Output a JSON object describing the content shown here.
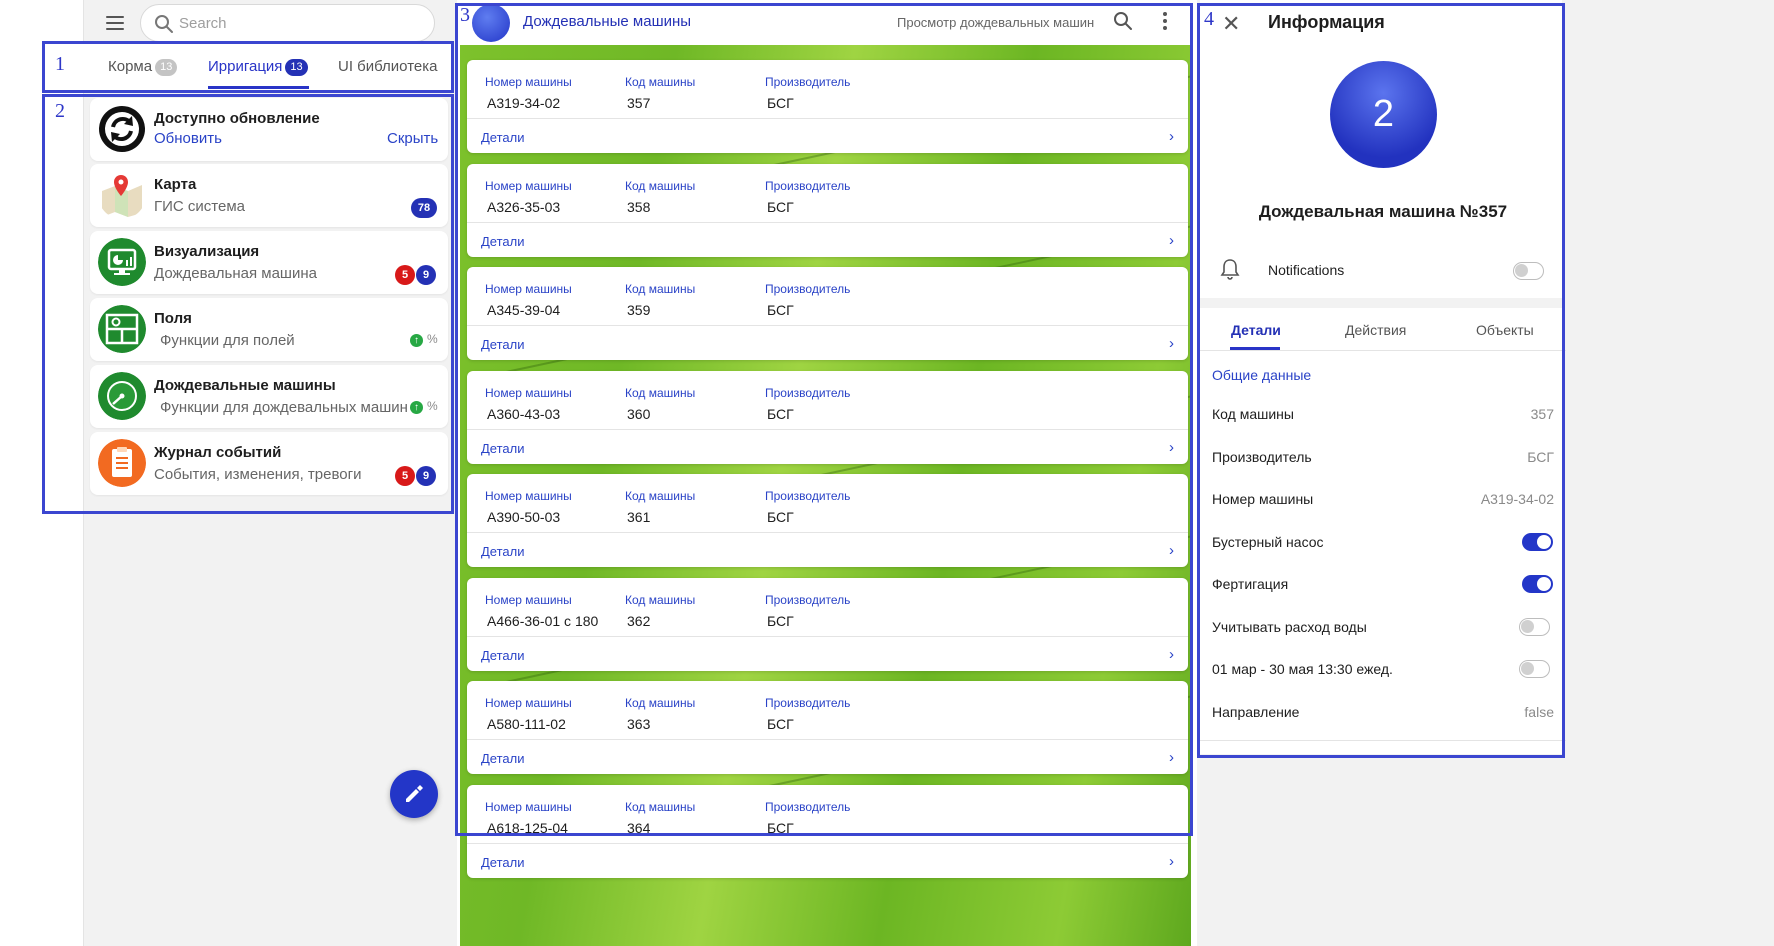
{
  "search": {
    "placeholder": "Search"
  },
  "frame_labels": [
    "1",
    "2",
    "3",
    "4"
  ],
  "tabs": [
    {
      "label": "Корма",
      "count": "13"
    },
    {
      "label": "Ирригация",
      "count": "13"
    },
    {
      "label": "UI библиотека"
    }
  ],
  "apps": {
    "update": {
      "title": "Доступно обновление",
      "action": "Обновить",
      "dismiss": "Скрыть"
    },
    "map": {
      "title": "Карта",
      "subtitle": "ГИС система",
      "badge": "78"
    },
    "viz": {
      "title": "Визуализация",
      "subtitle": "Дождевальная машина",
      "badge_red": "5",
      "badge_blue": "9"
    },
    "fields": {
      "title": "Поля",
      "subtitle": "Функции для полей",
      "trend": "%"
    },
    "machines": {
      "title": "Дождевальные машины",
      "subtitle": "Функции для дождевальных машин",
      "trend": "%"
    },
    "journal": {
      "title": "Журнал событий",
      "subtitle": "События, изменения, тревоги",
      "badge_red": "5",
      "badge_blue": "9"
    }
  },
  "machines_panel": {
    "title": "Дождевальные машины",
    "subtitle": "Просмотр дождевальных машин",
    "columns": [
      "Номер машины",
      "Код машины",
      "Производитель"
    ],
    "details_label": "Детали",
    "rows": [
      {
        "number": "А319-34-02",
        "code": "357",
        "maker": "БСГ"
      },
      {
        "number": "А326-35-03",
        "code": "358",
        "maker": "БСГ"
      },
      {
        "number": "А345-39-04",
        "code": "359",
        "maker": "БСГ"
      },
      {
        "number": "А360-43-03",
        "code": "360",
        "maker": "БСГ"
      },
      {
        "number": "А390-50-03",
        "code": "361",
        "maker": "БСГ"
      },
      {
        "number": "А466-36-01 с 180",
        "code": "362",
        "maker": "БСГ"
      },
      {
        "number": "А580-111-02",
        "code": "363",
        "maker": "БСГ"
      },
      {
        "number": "А618-125-04",
        "code": "364",
        "maker": "БСГ"
      }
    ]
  },
  "info": {
    "title": "Информация",
    "avatar": "2",
    "name": "Дождевальная машина №357",
    "notifications_label": "Notifications",
    "notifications_on": false,
    "tabs": [
      "Детали",
      "Действия",
      "Объекты"
    ],
    "section": "Общие данные",
    "rows": [
      {
        "label": "Код машины",
        "value": "357"
      },
      {
        "label": "Производитель",
        "value": "БСГ"
      },
      {
        "label": "Номер машины",
        "value": "А319-34-02"
      },
      {
        "label": "Бустерный насос",
        "toggle": true
      },
      {
        "label": "Фертигация",
        "toggle": true
      },
      {
        "label": "Учитывать расход воды",
        "toggle": false
      },
      {
        "label": "01 мар - 30 мая 13:30 ежед.",
        "toggle": false
      },
      {
        "label": "Направление",
        "value": "false"
      }
    ]
  },
  "colors": {
    "accent": "#2336c8",
    "frame": "#3b46d0",
    "badge_red": "#d81919",
    "badge_blue": "#2431b5"
  }
}
